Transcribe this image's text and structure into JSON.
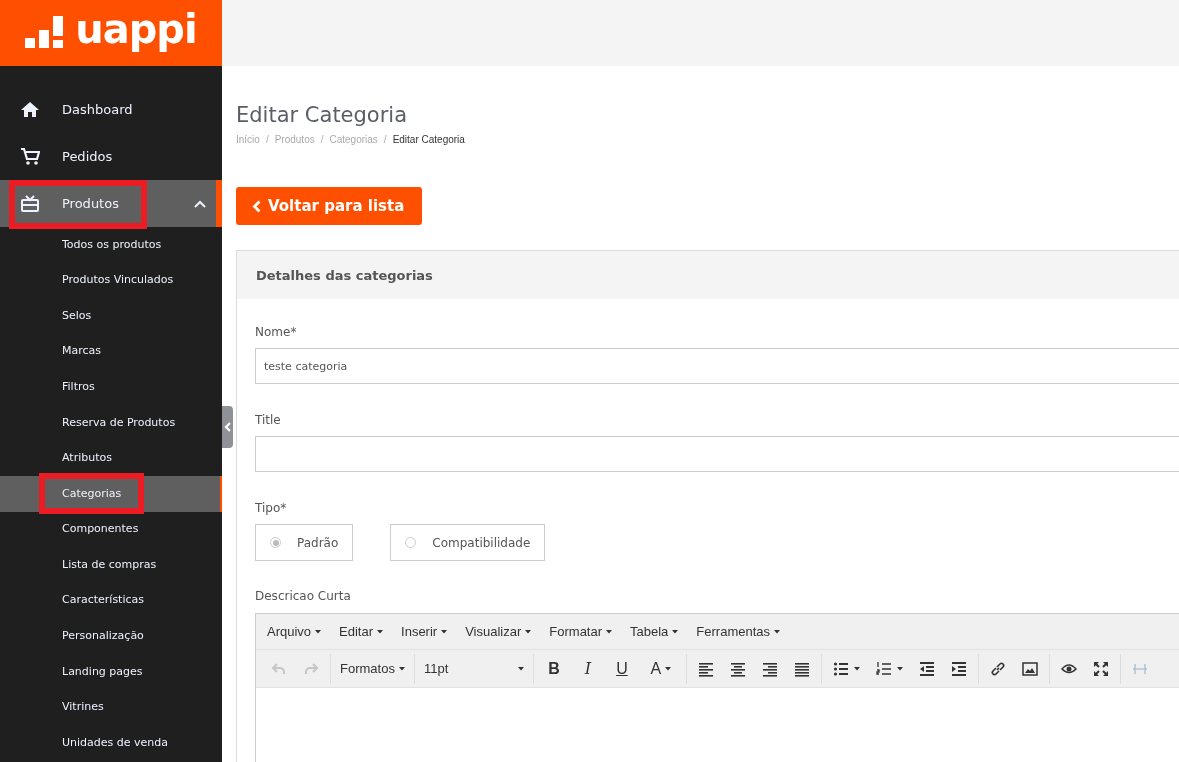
{
  "logo": {
    "text": "uappi"
  },
  "sidebar": {
    "items": [
      {
        "label": "Dashboard",
        "selected": false
      },
      {
        "label": "Pedidos",
        "selected": false
      },
      {
        "label": "Produtos",
        "selected": true,
        "expanded": true,
        "highlighted": true,
        "children": [
          {
            "label": "Todos os produtos",
            "selected": false,
            "highlighted": false
          },
          {
            "label": "Produtos Vinculados",
            "selected": false,
            "highlighted": false
          },
          {
            "label": "Selos",
            "selected": false,
            "highlighted": false
          },
          {
            "label": "Marcas",
            "selected": false,
            "highlighted": false
          },
          {
            "label": "Filtros",
            "selected": false,
            "highlighted": false
          },
          {
            "label": "Reserva de Produtos",
            "selected": false,
            "highlighted": false
          },
          {
            "label": "Atributos",
            "selected": false,
            "highlighted": false
          },
          {
            "label": "Categorias",
            "selected": true,
            "highlighted": true
          },
          {
            "label": "Componentes",
            "selected": false,
            "highlighted": false
          },
          {
            "label": "Lista de compras",
            "selected": false,
            "highlighted": false
          },
          {
            "label": "Características",
            "selected": false,
            "highlighted": false
          },
          {
            "label": "Personalização",
            "selected": false,
            "highlighted": false
          },
          {
            "label": "Landing pages",
            "selected": false,
            "highlighted": false
          },
          {
            "label": "Vitrines",
            "selected": false,
            "highlighted": false
          },
          {
            "label": "Unidades de venda",
            "selected": false,
            "highlighted": false
          }
        ]
      }
    ]
  },
  "page": {
    "title": "Editar Categoria",
    "breadcrumb": [
      "Início",
      "/",
      "Produtos",
      "/",
      "Categorias",
      "/",
      "Editar Categoria"
    ],
    "back_button": "Voltar para lista"
  },
  "panel": {
    "title": "Detalhes das categorias",
    "fields": [
      {
        "label": "Nome*",
        "value": "teste categoria"
      },
      {
        "label": "Title"
      }
    ],
    "tipo": {
      "label": "Tipo*",
      "options": [
        {
          "label": "Padrão",
          "selected": true
        },
        {
          "label": "Compatibilidade",
          "selected": false
        }
      ]
    },
    "editor": {
      "label": "Descricao Curta",
      "menu": [
        "Arquivo",
        "Editar",
        "Inserir",
        "Visualizar",
        "Formatar",
        "Tabela",
        "Ferramentas"
      ],
      "toolbar": [
        [
          {
            "kind": "undo",
            "disabled": true
          },
          {
            "kind": "redo",
            "disabled": true
          }
        ],
        [
          {
            "kind": "dropdown",
            "label": "Formatos",
            "disabled": false
          }
        ],
        [
          {
            "kind": "fontsize",
            "label": "11pt",
            "disabled": false
          }
        ],
        [
          {
            "kind": "bold",
            "label": "B",
            "disabled": false
          },
          {
            "kind": "italic",
            "label": "I",
            "disabled": false
          },
          {
            "kind": "underline",
            "label": "U",
            "disabled": false
          },
          {
            "kind": "color",
            "label": "A",
            "disabled": false
          }
        ],
        [
          {
            "kind": "align-left",
            "disabled": false
          },
          {
            "kind": "align-center",
            "disabled": false
          },
          {
            "kind": "align-right",
            "disabled": false
          },
          {
            "kind": "justify",
            "disabled": false
          }
        ],
        [
          {
            "kind": "bullets",
            "disabled": false
          },
          {
            "kind": "numbers",
            "disabled": false
          },
          {
            "kind": "outdent",
            "disabled": false
          },
          {
            "kind": "indent",
            "disabled": false
          }
        ],
        [
          {
            "kind": "link",
            "disabled": false
          },
          {
            "kind": "image",
            "disabled": false
          }
        ],
        [
          {
            "kind": "preview",
            "disabled": false
          },
          {
            "kind": "fullscreen",
            "disabled": false
          }
        ],
        [
          {
            "kind": "hr",
            "disabled": true
          }
        ]
      ]
    }
  }
}
